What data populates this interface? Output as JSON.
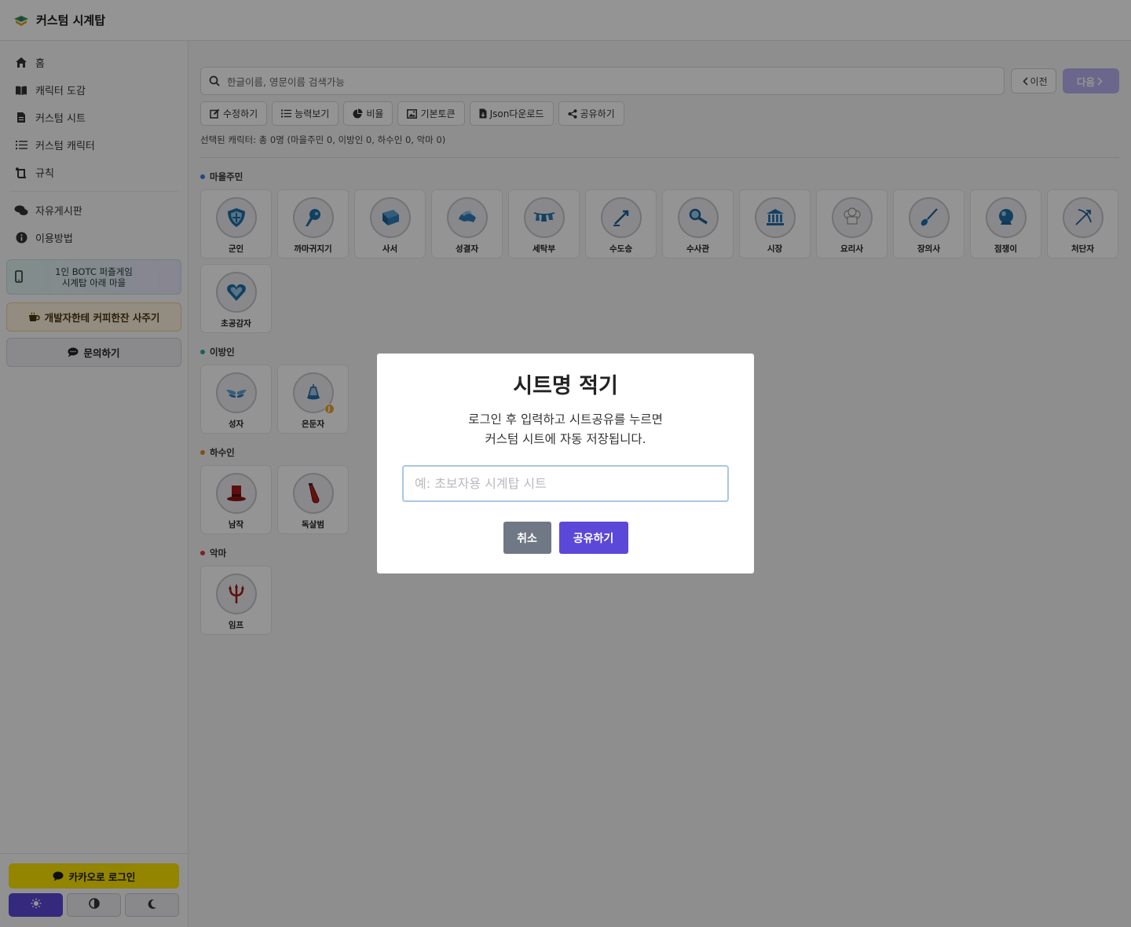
{
  "header": {
    "title": "커스텀 시계탑"
  },
  "sidebar": {
    "nav": [
      {
        "label": "홈",
        "icon": "home-icon"
      },
      {
        "label": "캐릭터 도감",
        "icon": "book-icon"
      },
      {
        "label": "커스텀 시트",
        "icon": "file-icon"
      },
      {
        "label": "커스텀 캐릭터",
        "icon": "list-icon"
      },
      {
        "label": "규칙",
        "icon": "scroll-icon"
      }
    ],
    "nav2": [
      {
        "label": "자유게시판",
        "icon": "comments-icon"
      },
      {
        "label": "이용방법",
        "icon": "info-icon"
      }
    ],
    "promo_line1": "1인 BOTC 퍼즐게임",
    "promo_line2": "시계탑 아래 마을",
    "coffee_label": "개발자한테 커피한잔 사주기",
    "inquiry_label": "문의하기",
    "kakao_label": "카카오로 로그인"
  },
  "search": {
    "placeholder": "한글이름, 영문이름 검색가능"
  },
  "pager": {
    "prev": "이전",
    "next": "다음"
  },
  "toolbar": {
    "edit": "수정하기",
    "abilities": "능력보기",
    "ratio": "비율",
    "token": "기본토큰",
    "json": "Json다운로드",
    "share": "공유하기"
  },
  "selected_info": "선택된 캐릭터: 총 0명 (마을주민 0, 이방인 0, 하수인 0, 악마 0)",
  "groups": {
    "townsfolk": {
      "title": "마을주민",
      "color": "#3b7be0",
      "items": [
        "군인",
        "까마귀지기",
        "사서",
        "성결자",
        "세탁부",
        "수도승",
        "수사관",
        "시장",
        "요리사",
        "장의사",
        "점쟁이",
        "처단자",
        "초공감자"
      ]
    },
    "outsider": {
      "title": "이방인",
      "color": "#2aa8a0",
      "items": [
        "성자",
        "은둔자"
      ],
      "jinx": "J"
    },
    "minion": {
      "title": "하수인",
      "color": "#e08a1e",
      "items": [
        "남작",
        "독살범"
      ]
    },
    "demon": {
      "title": "악마",
      "color": "#d43a3a",
      "items": [
        "임프"
      ]
    }
  },
  "modal": {
    "title": "시트명 적기",
    "line1": "로그인 후 입력하고 시트공유를 누르면",
    "line2": "커스텀 시트에 자동 저장됩니다.",
    "placeholder": "예: 초보자용 시계탑 시트",
    "cancel": "취소",
    "confirm": "공유하기"
  }
}
